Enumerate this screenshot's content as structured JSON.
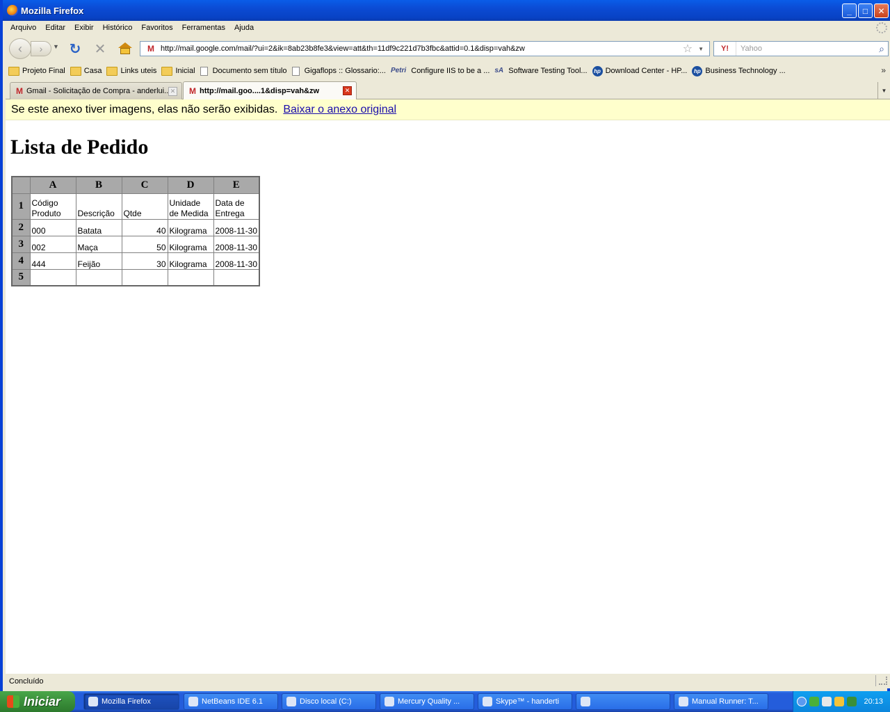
{
  "window": {
    "title": "Mozilla Firefox"
  },
  "menu": [
    "Arquivo",
    "Editar",
    "Exibir",
    "Histórico",
    "Favoritos",
    "Ferramentas",
    "Ajuda"
  ],
  "nav": {
    "url": "http://mail.google.com/mail/?ui=2&ik=8ab23b8fe3&view=att&th=11df9c221d7b3fbc&attid=0.1&disp=vah&zw",
    "search_placeholder": "Yahoo",
    "search_engine": "Y!"
  },
  "bookmarks": [
    {
      "label": "Projeto Final",
      "icon": "folder-icon"
    },
    {
      "label": "Casa",
      "icon": "folder-icon"
    },
    {
      "label": "Links uteis",
      "icon": "folder-icon"
    },
    {
      "label": "Inicial",
      "icon": "folder-icon"
    },
    {
      "label": "Documento sem título",
      "icon": "page-icon"
    },
    {
      "label": "Gigaflops :: Glossario:...",
      "icon": "page-icon"
    },
    {
      "label": "Configure IIS to be a ...",
      "icon": "petri-icon",
      "badge": "Petri"
    },
    {
      "label": "Software Testing Tool...",
      "icon": "sqa-icon",
      "badge": "sA"
    },
    {
      "label": "Download Center - HP...",
      "icon": "hp-icon",
      "badge": "hp"
    },
    {
      "label": "Business Technology ...",
      "icon": "hp-icon",
      "badge": "hp"
    }
  ],
  "tabs": [
    {
      "label": "Gmail - Solicitação de Compra - anderlui...",
      "active": false
    },
    {
      "label": "http://mail.goo....1&disp=vah&zw",
      "active": true
    }
  ],
  "notice": {
    "text": "Se este anexo tiver imagens, elas não serão exibidas.",
    "link": "Baixar o anexo original"
  },
  "document": {
    "title": "Lista de Pedido",
    "columns": [
      "A",
      "B",
      "C",
      "D",
      "E"
    ],
    "rows": [
      {
        "n": "1",
        "cells": [
          "Código Produto",
          "Descrição",
          "Qtde",
          "Unidade de Medida",
          "Data de Entrega"
        ]
      },
      {
        "n": "2",
        "cells": [
          "000",
          "Batata",
          "40",
          "Kilograma",
          "2008-11-30"
        ]
      },
      {
        "n": "3",
        "cells": [
          "002",
          "Maça",
          "50",
          "Kilograma",
          "2008-11-30"
        ]
      },
      {
        "n": "4",
        "cells": [
          "444",
          "Feijão",
          "30",
          "Kilograma",
          "2008-11-30"
        ]
      },
      {
        "n": "5",
        "cells": [
          "",
          "",
          "",
          "",
          ""
        ]
      }
    ]
  },
  "status": {
    "text": "Concluído"
  },
  "taskbar": {
    "start": "Iniciar",
    "tasks": [
      {
        "label": "Mozilla Firefox",
        "active": true
      },
      {
        "label": "NetBeans IDE 6.1",
        "active": false
      },
      {
        "label": "Disco local (C:)",
        "active": false
      },
      {
        "label": "Mercury Quality ...",
        "active": false
      },
      {
        "label": "Skype™ - handerti",
        "active": false
      },
      {
        "label": "",
        "active": false
      },
      {
        "label": "Manual Runner: T...",
        "active": false
      }
    ],
    "clock": "20:13"
  }
}
